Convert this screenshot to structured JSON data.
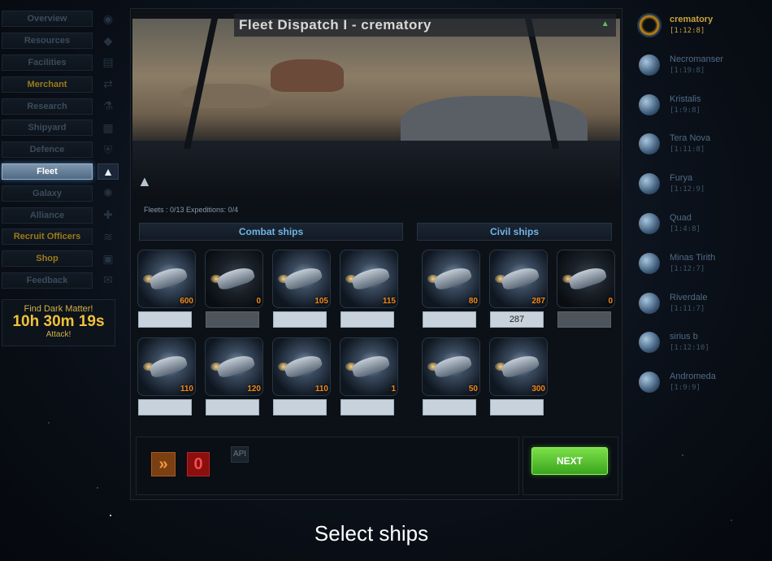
{
  "nav": {
    "items": [
      {
        "label": "Overview",
        "icon": "planet-icon",
        "style": "normal"
      },
      {
        "label": "Resources",
        "icon": "crystal-icon",
        "style": "normal"
      },
      {
        "label": "Facilities",
        "icon": "factory-icon",
        "style": "normal"
      },
      {
        "label": "Merchant",
        "icon": "exchange-icon",
        "style": "gold"
      },
      {
        "label": "Research",
        "icon": "flask-icon",
        "style": "normal"
      },
      {
        "label": "Shipyard",
        "icon": "shipyard-icon",
        "style": "normal"
      },
      {
        "label": "Defence",
        "icon": "shield-icon",
        "style": "normal"
      },
      {
        "label": "Fleet",
        "icon": "fleet-icon",
        "style": "active"
      },
      {
        "label": "Galaxy",
        "icon": "galaxy-icon",
        "style": "normal"
      },
      {
        "label": "Alliance",
        "icon": "alliance-icon",
        "style": "normal"
      },
      {
        "label": "Recruit Officers",
        "icon": "officer-icon",
        "style": "gold"
      },
      {
        "label": "Shop",
        "icon": "gift-icon",
        "style": "gold"
      },
      {
        "label": "Feedback",
        "icon": "feedback-icon",
        "style": "normal"
      }
    ]
  },
  "dark_matter": {
    "title": "Find Dark Matter!",
    "timer": "10h 30m 19s",
    "action": "Attack!"
  },
  "main": {
    "title": "Fleet Dispatch I - crematory",
    "fleet_status": "Fleets : 0/13   Expeditions: 0/4",
    "combat_header": "Combat ships",
    "civil_header": "Civil ships"
  },
  "combat_ships": [
    {
      "count": "600",
      "value": "",
      "disabled": false
    },
    {
      "count": "0",
      "value": "",
      "disabled": true
    },
    {
      "count": "105",
      "value": "",
      "disabled": false
    },
    {
      "count": "115",
      "value": "",
      "disabled": false
    },
    {
      "count": "110",
      "value": "",
      "disabled": false
    },
    {
      "count": "120",
      "value": "",
      "disabled": false
    },
    {
      "count": "110",
      "value": "",
      "disabled": false
    },
    {
      "count": "1",
      "value": "",
      "disabled": false
    }
  ],
  "civil_ships": [
    {
      "count": "80",
      "value": "",
      "disabled": false
    },
    {
      "count": "287",
      "value": "287",
      "disabled": false
    },
    {
      "count": "0",
      "value": "",
      "disabled": true
    },
    {
      "count": "50",
      "value": "",
      "disabled": false
    },
    {
      "count": "300",
      "value": "",
      "disabled": false
    }
  ],
  "controls": {
    "all_label": "»",
    "zero_label": "0",
    "api_label": "API",
    "next_label": "NEXT"
  },
  "planets": [
    {
      "name": "crematory",
      "coords": "[1:12:8]",
      "selected": true
    },
    {
      "name": "Necromanser",
      "coords": "[1:19:8]",
      "selected": false
    },
    {
      "name": "Kristalis",
      "coords": "[1:9:8]",
      "selected": false
    },
    {
      "name": "Tera Nova",
      "coords": "[1:11:8]",
      "selected": false
    },
    {
      "name": "Furya",
      "coords": "[1:12:9]",
      "selected": false
    },
    {
      "name": "Quad",
      "coords": "[1:4:8]",
      "selected": false
    },
    {
      "name": "Minas Tirith",
      "coords": "[1:12:7]",
      "selected": false
    },
    {
      "name": "Riverdale",
      "coords": "[1:11:7]",
      "selected": false
    },
    {
      "name": "sirius b",
      "coords": "[1:12:10]",
      "selected": false
    },
    {
      "name": "Andromeda",
      "coords": "[1:9:9]",
      "selected": false
    }
  ],
  "caption": "Select ships"
}
